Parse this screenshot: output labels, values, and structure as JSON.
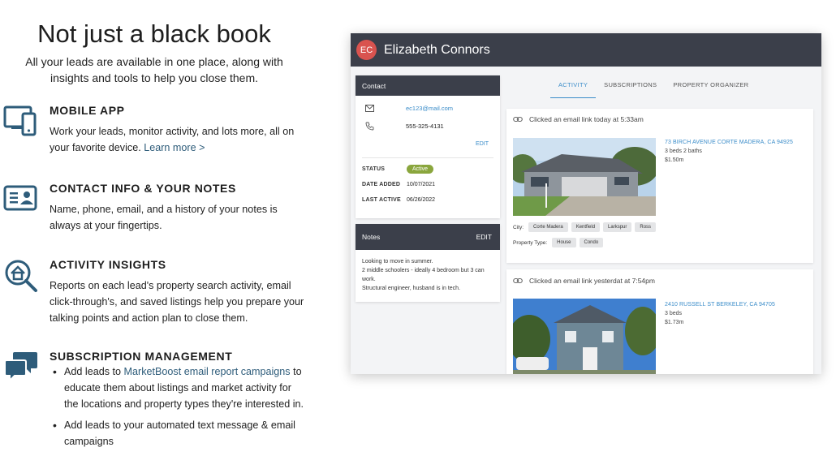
{
  "marketing": {
    "headline": "Not just a black book",
    "subheadline": "All your leads are available in one place, along with insights and tools to help you close them.",
    "features": [
      {
        "icon": "mobile-devices-icon",
        "title": "MOBILE APP",
        "body": "Work your leads, monitor activity, and lots more, all on your favorite device.",
        "link": "Learn more >"
      },
      {
        "icon": "contact-card-icon",
        "title": "CONTACT INFO & YOUR NOTES",
        "body": "Name, phone, email, and a history of your notes is always at your fingertips."
      },
      {
        "icon": "home-search-icon",
        "title": "ACTIVITY INSIGHTS",
        "body": "Reports on each lead's property search activity, email click-through's, and saved listings help you prepare your talking points and action plan to close them."
      },
      {
        "icon": "chat-bubbles-icon",
        "title": "SUBSCRIPTION MANAGEMENT",
        "bullet1_pre": "Add leads to ",
        "bullet1_link": "MarketBoost email report campaigns",
        "bullet1_post": " to educate them about listings and market activity for the locations and property types they're interested in.",
        "bullet2": "Add leads to your automated text message & email campaigns"
      }
    ]
  },
  "app": {
    "avatar_initials": "EC",
    "lead_name": "Elizabeth Connors",
    "contact": {
      "title": "Contact",
      "email": "ec123@mail.com",
      "phone": "555-325-4131",
      "edit_label": "EDIT",
      "status_label": "STATUS",
      "status_value": "Active",
      "date_added_label": "DATE ADDED",
      "date_added_value": "10/07/2021",
      "last_active_label": "LAST ACTIVE",
      "last_active_value": "06/26/2022"
    },
    "notes": {
      "title": "Notes",
      "edit_label": "EDIT",
      "line1": "Looking to move in summer.",
      "line2": "2 middle schoolers - ideally 4 bedroom but 3 can work.",
      "line3": "Structural engineer, husband is in tech."
    },
    "tabs": [
      "ACTIVITY",
      "SUBSCRIPTIONS",
      "PROPERTY ORGANIZER"
    ],
    "activity": [
      {
        "event": "Clicked an email link today at 5:33am",
        "address": "73 BIRCH AVENUE CORTE MADERA, CA 94925",
        "details": "3 beds  2 baths",
        "price": "$1.50m",
        "city_label": "City:",
        "cities": [
          "Corte Madera",
          "Kentfield",
          "Larkspur",
          "Ross"
        ],
        "ptype_label": "Property Type:",
        "ptypes": [
          "House",
          "Condo"
        ]
      },
      {
        "event": "Clicked an email link yesterdat at 7:54pm",
        "address": "2410 RUSSELL ST BERKELEY, CA 94705",
        "details": "3 beds",
        "price": "$1.73m"
      }
    ],
    "colors": {
      "header": "#3b3f4a",
      "accent": "#3a8cc9",
      "active_badge": "#8aa63d",
      "icon_teal": "#2e5c7a"
    }
  }
}
